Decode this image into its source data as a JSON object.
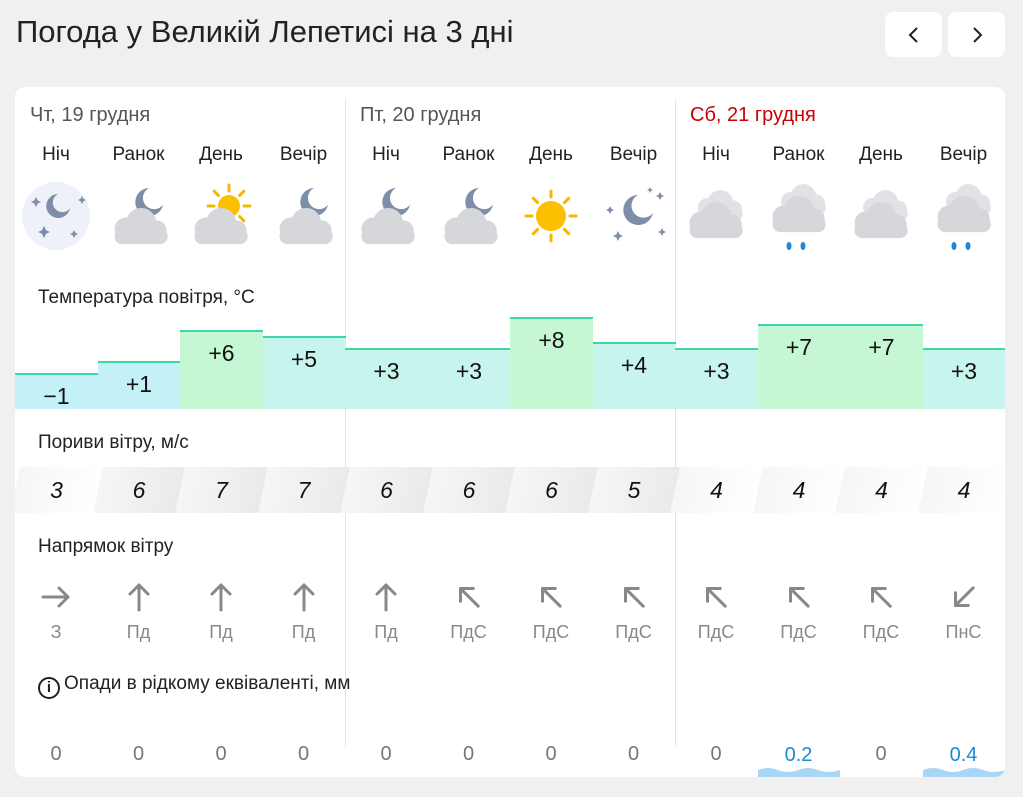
{
  "header": {
    "title": "Погода у Великій Лепетисі на 3 дні"
  },
  "days": [
    {
      "label": "Чт, 19 грудня",
      "weekend": false
    },
    {
      "label": "Пт, 20 грудня",
      "weekend": false
    },
    {
      "label": "Сб, 21 грудня",
      "weekend": true
    }
  ],
  "sections": {
    "temperature": "Температура повітря, °C",
    "gusts": "Пориви вітру, м/с",
    "direction": "Напрямок вітру",
    "precipitation": "Опади в рідкому еквіваленті, мм",
    "info_glyph": "i"
  },
  "periods": [
    {
      "part": "Ніч",
      "icon": "night-cloudy-snow-icon",
      "temp": "−1",
      "temp_value": -1,
      "gust": "3",
      "dir_arrow": "→",
      "dir": "З",
      "prec": "0",
      "prec_value": 0
    },
    {
      "part": "Ранок",
      "icon": "moon-cloud-icon",
      "temp": "+1",
      "temp_value": 1,
      "gust": "6",
      "dir_arrow": "↑",
      "dir": "Пд",
      "prec": "0",
      "prec_value": 0
    },
    {
      "part": "День",
      "icon": "sun-cloud-icon",
      "temp": "+6",
      "temp_value": 6,
      "gust": "7",
      "dir_arrow": "↑",
      "dir": "Пд",
      "prec": "0",
      "prec_value": 0
    },
    {
      "part": "Вечір",
      "icon": "moon-cloud-icon",
      "temp": "+5",
      "temp_value": 5,
      "gust": "7",
      "dir_arrow": "↑",
      "dir": "Пд",
      "prec": "0",
      "prec_value": 0
    },
    {
      "part": "Ніч",
      "icon": "moon-cloud-icon",
      "temp": "+3",
      "temp_value": 3,
      "gust": "6",
      "dir_arrow": "↑",
      "dir": "Пд",
      "prec": "0",
      "prec_value": 0
    },
    {
      "part": "Ранок",
      "icon": "moon-cloud-icon",
      "temp": "+3",
      "temp_value": 3,
      "gust": "6",
      "dir_arrow": "↖",
      "dir": "ПдС",
      "prec": "0",
      "prec_value": 0
    },
    {
      "part": "День",
      "icon": "sun-icon",
      "temp": "+8",
      "temp_value": 8,
      "gust": "6",
      "dir_arrow": "↖",
      "dir": "ПдС",
      "prec": "0",
      "prec_value": 0
    },
    {
      "part": "Вечір",
      "icon": "clear-night-icon",
      "temp": "+4",
      "temp_value": 4,
      "gust": "5",
      "dir_arrow": "↖",
      "dir": "ПдС",
      "prec": "0",
      "prec_value": 0
    },
    {
      "part": "Ніч",
      "icon": "cloudy-icon",
      "temp": "+3",
      "temp_value": 3,
      "gust": "4",
      "dir_arrow": "↖",
      "dir": "ПдС",
      "prec": "0",
      "prec_value": 0
    },
    {
      "part": "Ранок",
      "icon": "rain-icon",
      "temp": "+7",
      "temp_value": 7,
      "gust": "4",
      "dir_arrow": "↖",
      "dir": "ПдС",
      "prec": "0.2",
      "prec_value": 0.2
    },
    {
      "part": "День",
      "icon": "cloudy-icon",
      "temp": "+7",
      "temp_value": 7,
      "gust": "4",
      "dir_arrow": "↖",
      "dir": "ПдС",
      "prec": "0",
      "prec_value": 0
    },
    {
      "part": "Вечір",
      "icon": "rain-icon",
      "temp": "+3",
      "temp_value": 3,
      "gust": "4",
      "dir_arrow": "↙",
      "dir": "ПнС",
      "prec": "0.4",
      "prec_value": 0.4
    }
  ],
  "colors": {
    "cold": "#c4f0f8",
    "cool": "#c8f4ee",
    "warm": "#c6f7d4",
    "temp_line": "#3ed6a6",
    "gust_bg": "#e9eaec",
    "weekend": "#cc0000",
    "rain": "#1a8ad4"
  }
}
